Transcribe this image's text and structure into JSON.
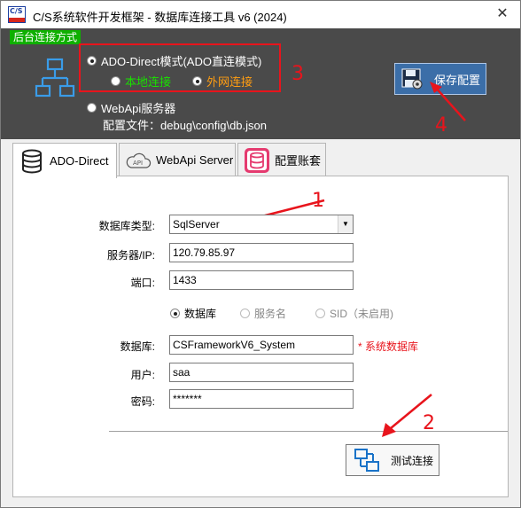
{
  "window": {
    "title": "C/S系统软件开发框架 - 数据库连接工具 v6 (2024)",
    "icon_text": "C/S",
    "close_glyph": "✕"
  },
  "top": {
    "badge": "后台连接方式",
    "ado_label": "ADO-Direct模式(ADO直连模式)",
    "local_label": "本地连接",
    "remote_label": "外网连接",
    "webapi_label": "WebApi服务器",
    "config_text": "配置文件：debug\\config\\db.json",
    "save_label": "保存配置",
    "local_color": "#19e000",
    "remote_color": "#ff9d12"
  },
  "tabs": [
    {
      "label": "ADO-Direct",
      "icon": "database-icon"
    },
    {
      "label": "WebApi Server",
      "icon": "cloud-api-icon"
    },
    {
      "label": "配置账套",
      "icon": "database-stack-icon"
    }
  ],
  "form": {
    "db_type_label": "数据库类型:",
    "db_type_value": "SqlServer",
    "server_label": "服务器/IP:",
    "server_value": "120.79.85.97",
    "port_label": "端口:",
    "port_value": "1433",
    "opt_database": "数据库",
    "opt_service": "服务名",
    "opt_sid": "SID（未启用)",
    "database_label": "数据库:",
    "database_value": "CSFrameworkV6_System",
    "system_db_note": "* 系统数据库",
    "user_label": "用户:",
    "user_value": "saa",
    "password_label": "密码:",
    "password_value": "*******",
    "test_label": "测试连接"
  },
  "annotations": {
    "n1": "1",
    "n2": "2",
    "n3": "3",
    "n4": "4",
    "color": "#e8141c"
  }
}
